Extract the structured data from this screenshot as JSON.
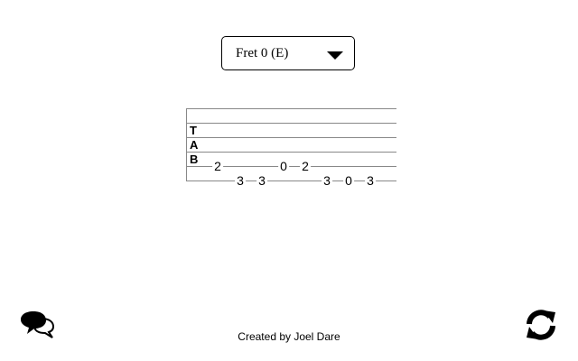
{
  "fret_select": {
    "selected": "Fret 0 (E)",
    "arrow_icon": "triangle-down-icon"
  },
  "tab": {
    "letters": [
      "T",
      "A",
      "B"
    ],
    "notes": [
      {
        "string": 5,
        "fret": "2"
      },
      {
        "string": 6,
        "fret": "3"
      },
      {
        "string": 6,
        "fret": "3"
      },
      {
        "string": 5,
        "fret": "0"
      },
      {
        "string": 5,
        "fret": "2"
      },
      {
        "string": 6,
        "fret": "3"
      },
      {
        "string": 6,
        "fret": "0"
      },
      {
        "string": 6,
        "fret": "3"
      }
    ]
  },
  "footer": {
    "credit": "Created by Joel Dare"
  },
  "icons": {
    "feedback": "chat-bubbles-icon",
    "refresh": "refresh-icon"
  }
}
